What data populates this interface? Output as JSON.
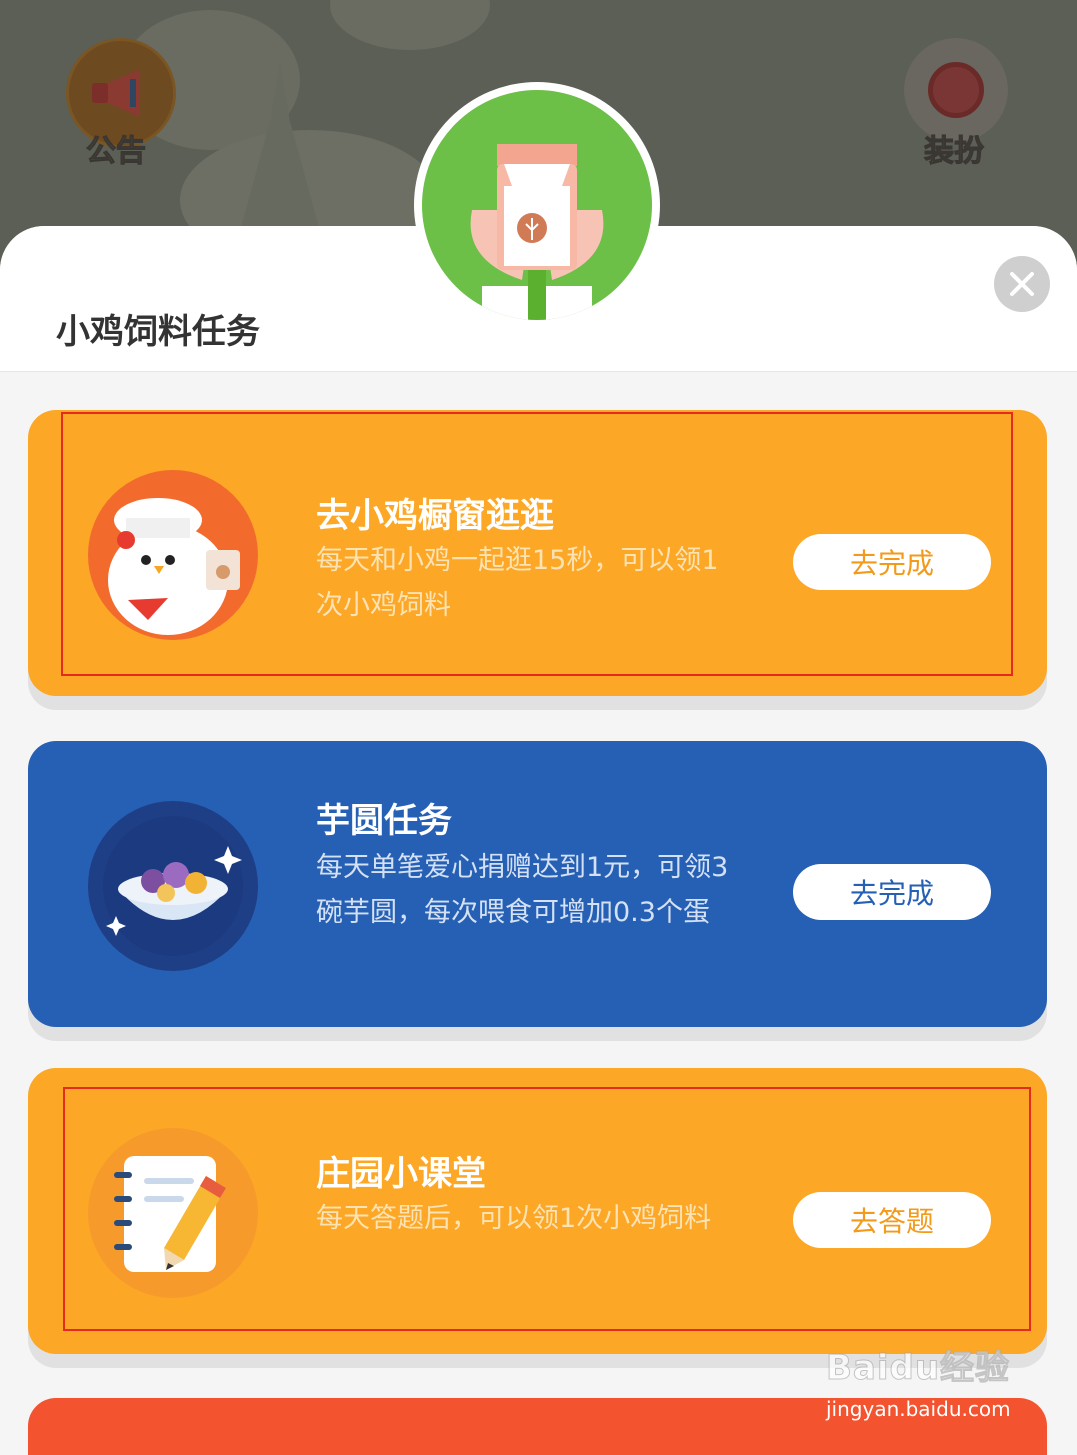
{
  "background": {
    "left_button_label": "公告",
    "right_button_label": "装扮"
  },
  "sheet": {
    "title": "小鸡饲料任务"
  },
  "tasks": [
    {
      "title": "去小鸡橱窗逛逛",
      "desc": "每天和小鸡一起逛15秒，可以领1次小鸡饲料",
      "button": "去完成",
      "color": "#fca726"
    },
    {
      "title": "芋圆任务",
      "desc": "每天单笔爱心捐赠达到1元，可领3碗芋圆，每次喂食可增加0.3个蛋",
      "button": "去完成",
      "color": "#2560b5"
    },
    {
      "title": "庄园小课堂",
      "desc": "每天答题后，可以领1次小鸡饲料",
      "button": "去答题",
      "color": "#fca726"
    }
  ],
  "watermark": {
    "logo": "Baidu经验",
    "url": "jingyan.baidu.com"
  }
}
